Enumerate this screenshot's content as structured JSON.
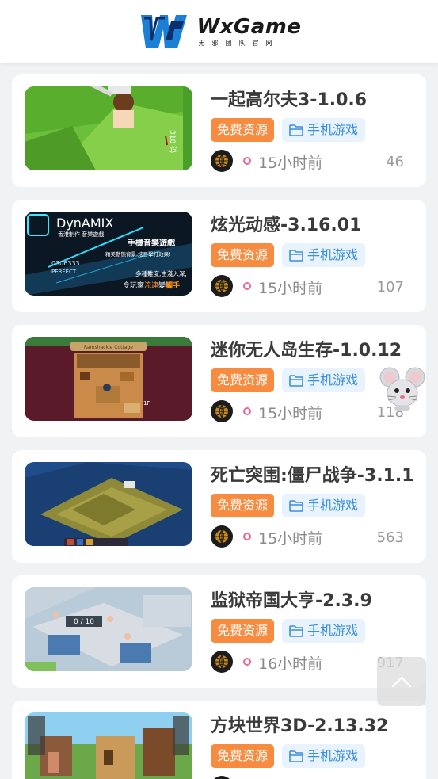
{
  "header": {
    "logo_name": "WxGame",
    "logo_sub": "无邪团队官网"
  },
  "posts": [
    {
      "title": "一起高尔夫3-1.0.6",
      "tag_free": "免费资源",
      "tag_category": "手机游戏",
      "time": "15小时前",
      "count": "46"
    },
    {
      "title": "炫光动感-3.16.01",
      "tag_free": "免费资源",
      "tag_category": "手机游戏",
      "time": "15小时前",
      "count": "107"
    },
    {
      "title": "迷你无人岛生存-1.0.12",
      "tag_free": "免费资源",
      "tag_category": "手机游戏",
      "time": "15小时前",
      "count": "118"
    },
    {
      "title": "死亡突围:僵尸战争-3.1.1",
      "tag_free": "免费资源",
      "tag_category": "手机游戏",
      "time": "15小时前",
      "count": "563"
    },
    {
      "title": "监狱帝国大亨-2.3.9",
      "tag_free": "免费资源",
      "tag_category": "手机游戏",
      "time": "16小时前",
      "count": "917"
    },
    {
      "title": "方块世界3D-2.13.32",
      "tag_free": "免费资源",
      "tag_category": "手机游戏",
      "time": "",
      "count": ""
    }
  ],
  "thumb_text": {
    "golf": "310 码",
    "dynamix_logo": "DynAMIX",
    "dynamix_sub": "香港制作 音樂遊戲",
    "dynamix_l1": "手機音樂遊戲",
    "dynamix_l2": "精美動態背景,炫目擊打效果!",
    "dynamix_l3": "多種難度,由淺入深,",
    "dynamix_l4": "令玩家",
    "dynamix_l4b": "流連",
    "dynamix_l4c": "變",
    "dynamix_l4d": "觸手",
    "dynamix_score": "0306333",
    "dynamix_perfect": "PERFECT",
    "island_sign": "Ramshackle Cottage",
    "island_floor": "1F",
    "prison_counter": "0 / 10"
  },
  "colors": {
    "tag_free_bg": "#f78c40",
    "tag_cat_bg": "#e8f3fd",
    "tag_cat_text": "#3c8fdc",
    "dot": "#f06292"
  },
  "icons": {
    "category": "folder-icon",
    "avatar": "globe-icon",
    "back_to_top": "chevron-up-icon",
    "mascot": "mouse-mascot-icon"
  }
}
